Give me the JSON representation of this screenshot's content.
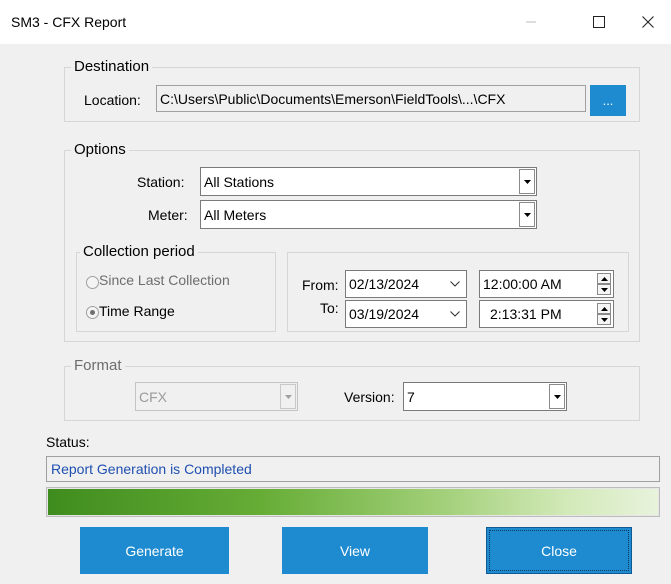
{
  "window": {
    "title": "SM3 - CFX Report"
  },
  "destination": {
    "group_label": "Destination",
    "location_label": "Location:",
    "location_value": "C:\\Users\\Public\\Documents\\Emerson\\FieldTools\\...\\CFX",
    "browse_label": "..."
  },
  "options": {
    "group_label": "Options",
    "station_label": "Station:",
    "station_value": "All Stations",
    "meter_label": "Meter:",
    "meter_value": "All Meters",
    "collection": {
      "group_label": "Collection period",
      "since_last_label": "Since Last Collection",
      "time_range_label": "Time Range",
      "selected": "Time Range"
    },
    "range": {
      "from_label": "From:",
      "from_date": "02/13/2024",
      "from_time": "12:00:00 AM",
      "to_label": "To:",
      "to_date": "03/19/2024",
      "to_time": "2:13:31 PM"
    }
  },
  "format": {
    "group_label": "Format",
    "format_value": "CFX",
    "version_label": "Version:",
    "version_value": "7"
  },
  "status": {
    "label": "Status:",
    "message": "Report Generation is Completed",
    "progress": 1.0
  },
  "buttons": {
    "generate": "Generate",
    "view": "View",
    "close": "Close"
  },
  "colors": {
    "accent": "#1e8bd0",
    "status_text": "#1f4fb0",
    "progress_green": "#5ea632"
  }
}
